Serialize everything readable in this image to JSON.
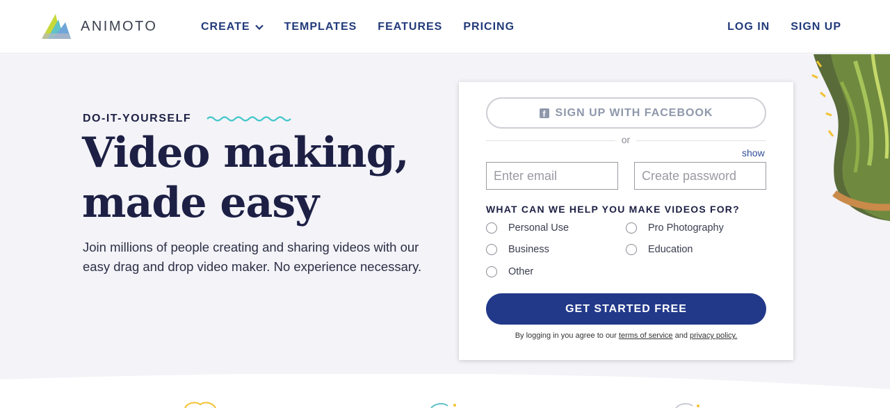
{
  "header": {
    "brand": "ANIMOTO",
    "nav": [
      {
        "label": "CREATE"
      },
      {
        "label": "TEMPLATES"
      },
      {
        "label": "FEATURES"
      },
      {
        "label": "PRICING"
      }
    ],
    "login_label": "LOG IN",
    "signup_label": "SIGN UP"
  },
  "hero": {
    "eyebrow": "DO-IT-YOURSELF",
    "headline_line1": "Video making,",
    "headline_line2": "made easy",
    "subtext": "Join millions of people creating and sharing videos with our easy drag and drop video maker. No experience necessary."
  },
  "signup_form": {
    "facebook_label": "SIGN UP WITH FACEBOOK",
    "or_label": "or",
    "show_label": "show",
    "email_placeholder": "Enter email",
    "password_placeholder": "Create password",
    "question": "WHAT CAN WE HELP YOU MAKE VIDEOS FOR?",
    "options": [
      "Personal Use",
      "Pro Photography",
      "Business",
      "Education",
      "Other"
    ],
    "cta_label": "GET STARTED FREE",
    "legal_prefix": "By logging in you agree to our",
    "terms_label": "terms of service",
    "legal_and": "and",
    "privacy_label": "privacy policy."
  },
  "colors": {
    "brand_navy": "#213a7a",
    "cta_blue": "#22398a",
    "hero_bg": "#f3f3f8",
    "headline": "#1d2044",
    "squiggle": "#3ec6c9"
  },
  "icons": {
    "logo": "animoto-logo-icon",
    "create_dropdown": "chevron-down-icon",
    "facebook": "facebook-icon"
  }
}
